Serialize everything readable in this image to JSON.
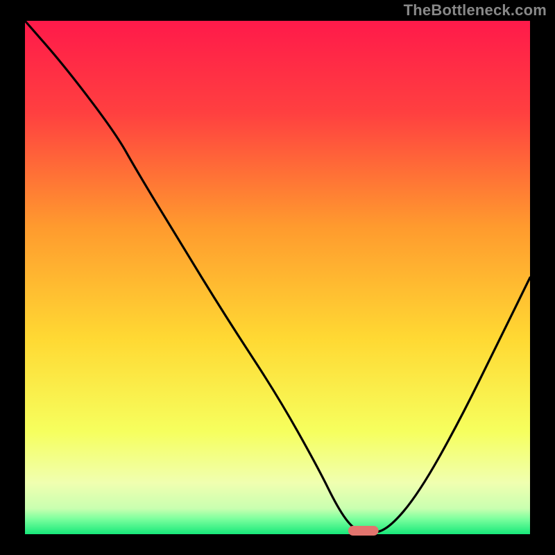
{
  "watermark": "TheBottleneck.com",
  "colors": {
    "frame": "#000000",
    "curve": "#000000",
    "marker": "#e2746e",
    "gradient_top": "#ff1a4a",
    "gradient_mid1": "#ff7a33",
    "gradient_mid2": "#ffd233",
    "gradient_mid3": "#f7ff66",
    "gradient_bottom_yellow": "#f0ffb3",
    "gradient_green": "#17e87a"
  },
  "chart_data": {
    "type": "line",
    "title": "",
    "xlabel": "",
    "ylabel": "",
    "xlim": [
      0,
      100
    ],
    "ylim": [
      0,
      100
    ],
    "x": [
      0,
      8,
      18,
      22,
      30,
      40,
      50,
      58,
      62,
      65,
      68,
      72,
      78,
      86,
      94,
      100
    ],
    "values": [
      100,
      91,
      78,
      71,
      58,
      42,
      27,
      13,
      5,
      1,
      0,
      1,
      8,
      22,
      38,
      50
    ],
    "minimum_marker": {
      "x_start": 64,
      "x_end": 70,
      "y": 0
    },
    "note": "Values are approximate readings of the black curve height as percent of plot height; x is percent across plot width."
  }
}
